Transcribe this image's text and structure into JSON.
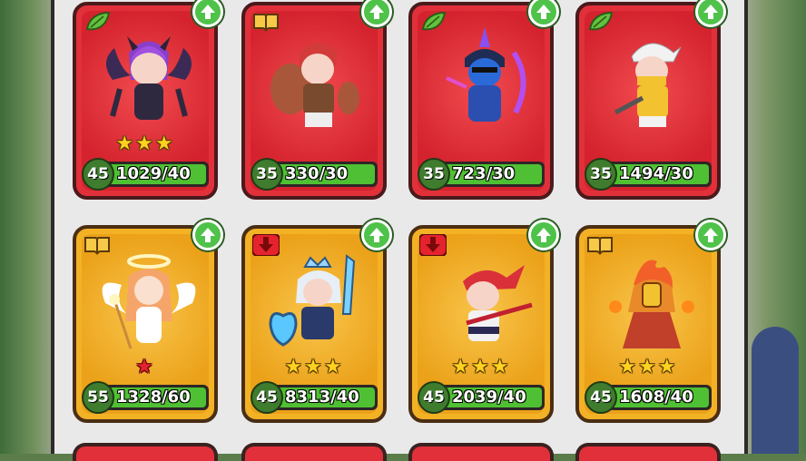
{
  "cards": [
    {
      "rarity": "red",
      "corner": "leaf",
      "level": "45",
      "progress": "1029/40",
      "stars": [
        "gold",
        "gold",
        "gold"
      ],
      "hero": "dark-witch"
    },
    {
      "rarity": "red",
      "corner": "book",
      "level": "35",
      "progress": "330/30",
      "stars": [],
      "hero": "red-haired-warrior"
    },
    {
      "rarity": "red",
      "corner": "leaf",
      "level": "35",
      "progress": "723/30",
      "stars": [],
      "hero": "masked-assassin"
    },
    {
      "rarity": "red",
      "corner": "leaf",
      "level": "35",
      "progress": "1494/30",
      "stars": [],
      "hero": "white-haired-ninja"
    },
    {
      "rarity": "gold",
      "corner": "book",
      "level": "55",
      "progress": "1328/60",
      "stars": [
        "red"
      ],
      "hero": "angel"
    },
    {
      "rarity": "gold",
      "corner": "red-arrow",
      "level": "45",
      "progress": "8313/40",
      "stars": [
        "gold",
        "gold",
        "gold"
      ],
      "hero": "ice-knight"
    },
    {
      "rarity": "gold",
      "corner": "red-arrow",
      "level": "45",
      "progress": "2039/40",
      "stars": [
        "gold",
        "gold",
        "gold"
      ],
      "hero": "ponytail-swordsman"
    },
    {
      "rarity": "gold",
      "corner": "book",
      "level": "45",
      "progress": "1608/40",
      "stars": [
        "gold",
        "gold",
        "gold"
      ],
      "hero": "fire-mage"
    }
  ],
  "colors": {
    "upgrade": "#4fc24a",
    "progress_fill": "#4fc033",
    "red_card": "#e2303b",
    "gold_card": "#f3b225"
  }
}
